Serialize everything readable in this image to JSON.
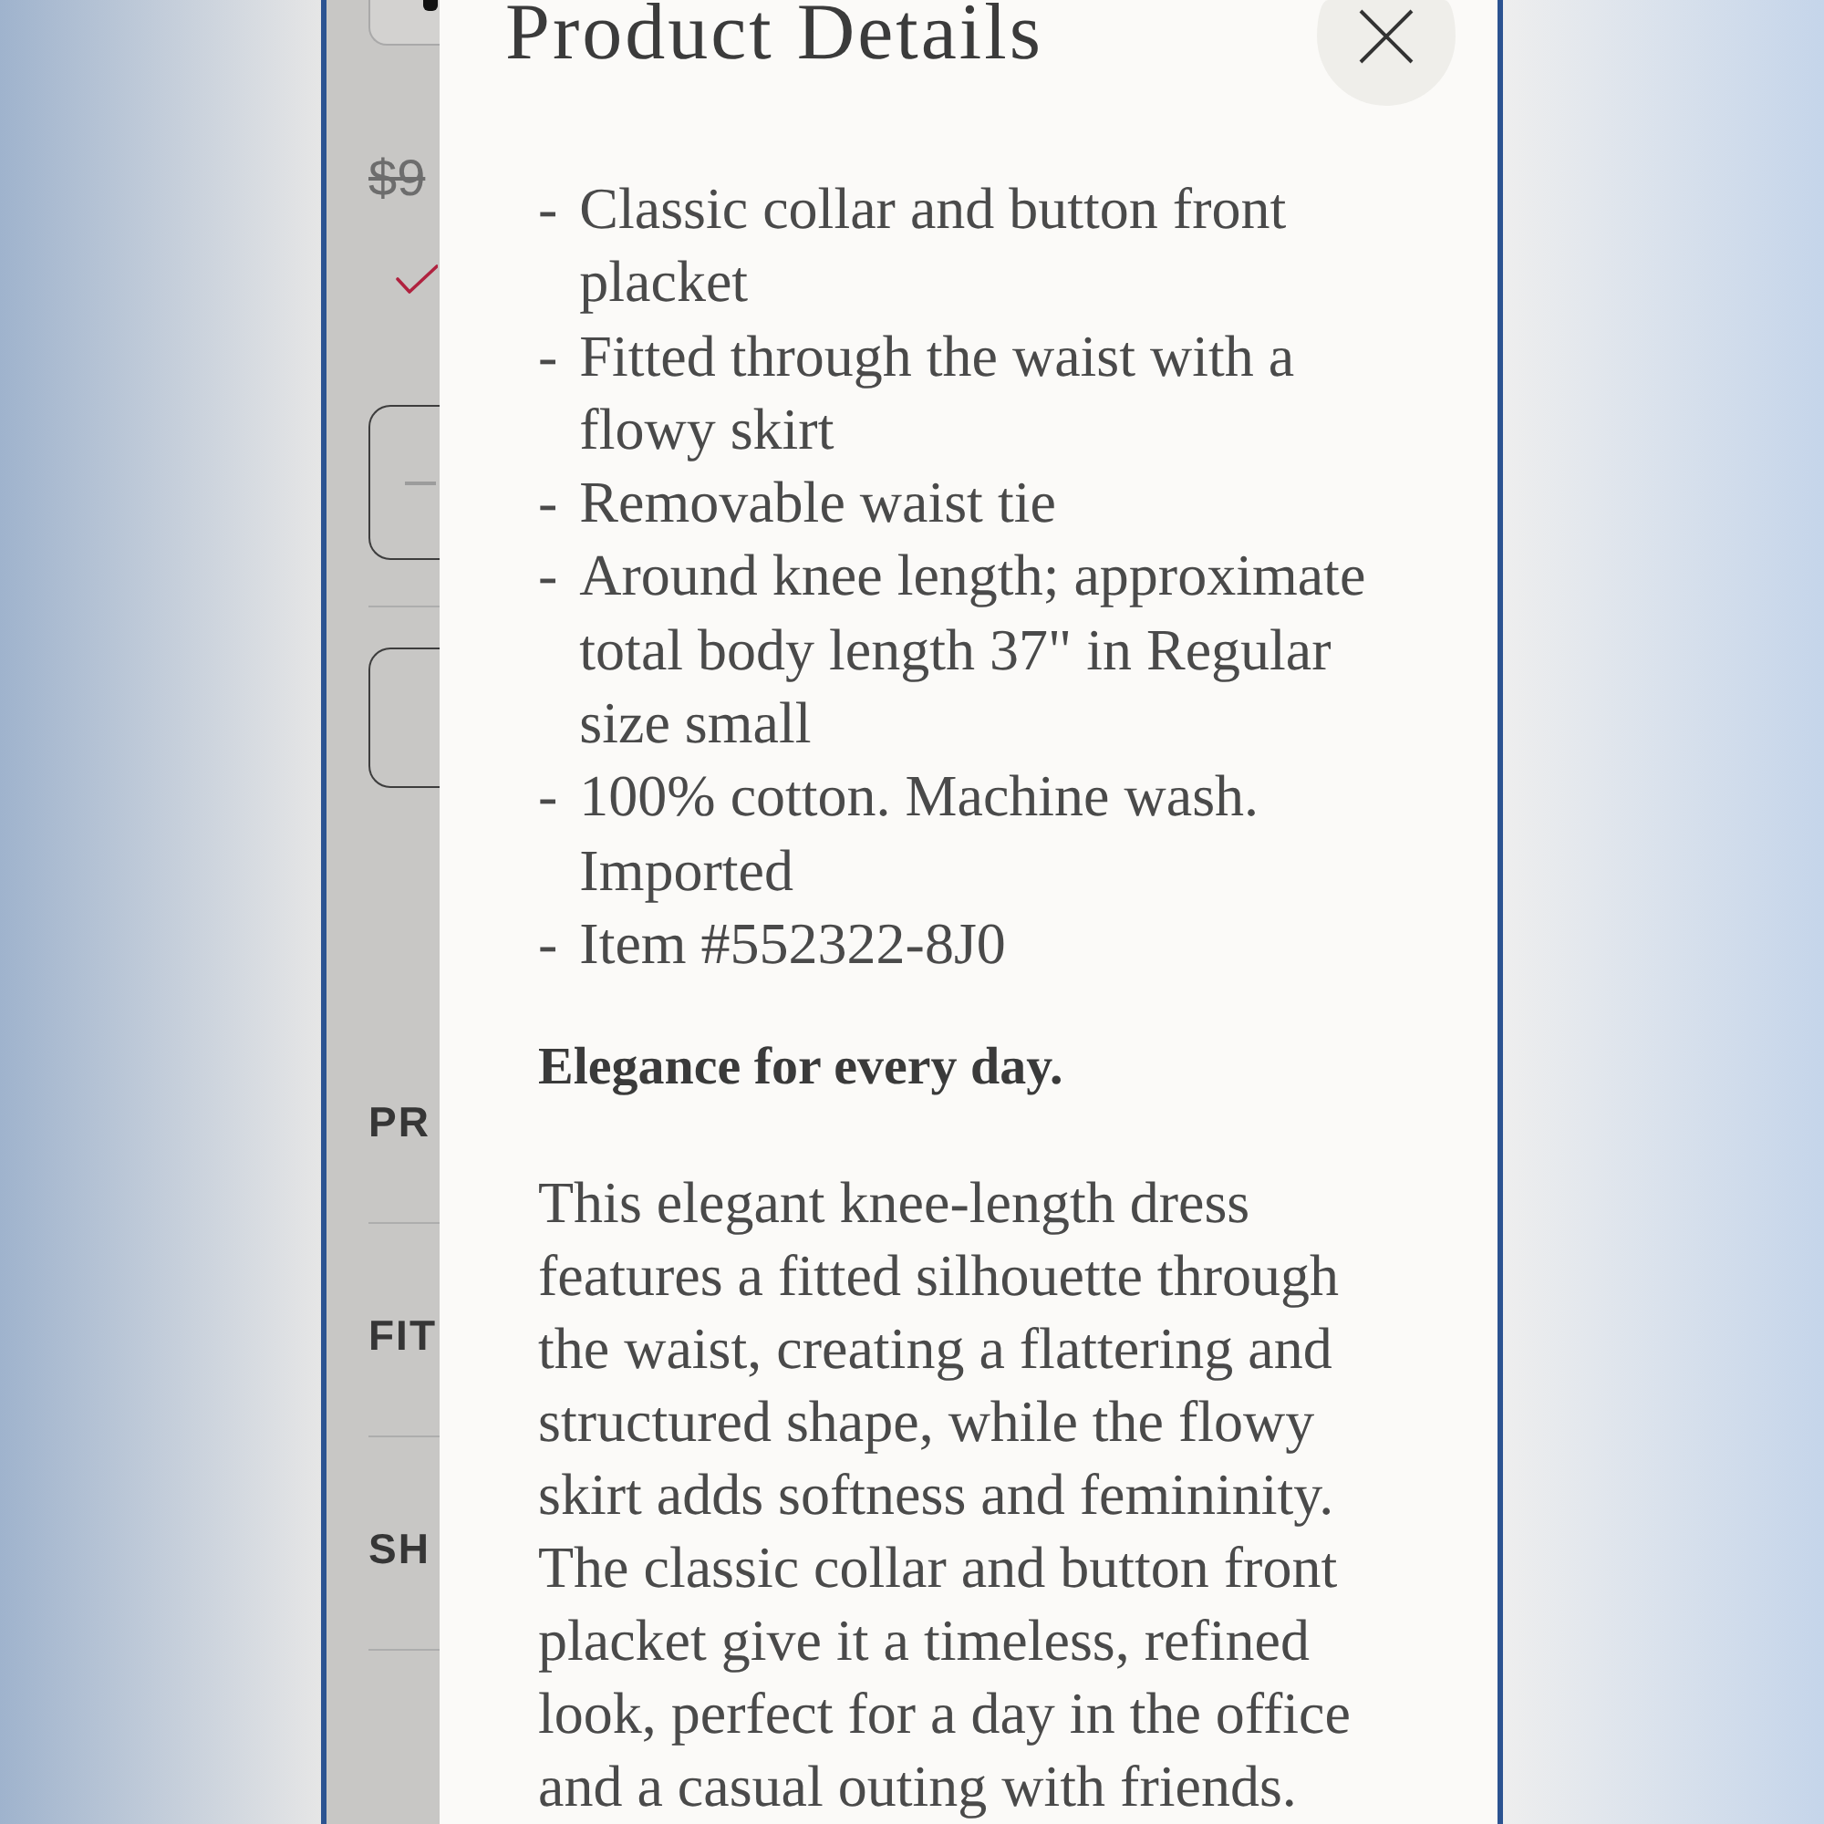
{
  "product_page": {
    "original_price": {
      "text": "$9",
      "struck_through": true
    },
    "sections": [
      {
        "label": "PR"
      },
      {
        "label": "FIT"
      },
      {
        "label": "SH"
      }
    ]
  },
  "details_modal": {
    "title": "Product Details",
    "features": [
      {
        "bullet": "-",
        "text": "Classic collar and button front placket"
      },
      {
        "bullet": "-",
        "text": "Fitted through the waist with a flowy skirt"
      },
      {
        "bullet": "-",
        "text": "Removable waist tie"
      },
      {
        "bullet": "-",
        "text": "Around knee length; approximate total body length 37\" in Regular size small"
      },
      {
        "bullet": "-",
        "text": "100% cotton. Machine wash. Imported"
      },
      {
        "bullet": "-",
        "text": "Item #552322-8J0"
      }
    ],
    "heading": "Elegance for every day.",
    "description": "This elegant knee-length dress features a fitted silhouette through the waist, creating a flattering and structured shape, while the flowy skirt adds softness and femininity. The classic collar and button front placket give it a timeless, refined look, perfect for a day in the office and a casual outing with friends."
  }
}
